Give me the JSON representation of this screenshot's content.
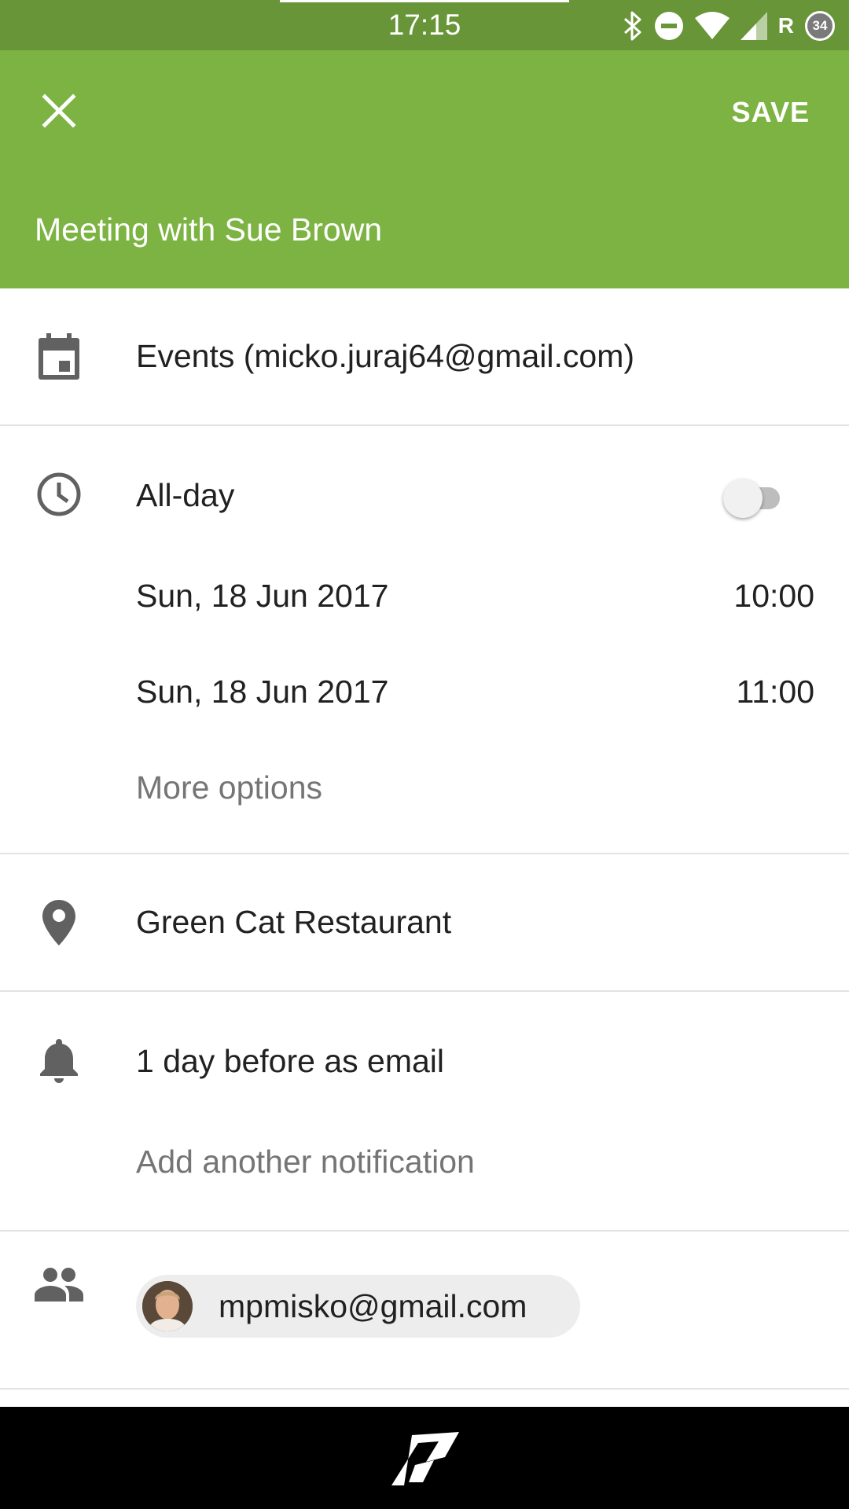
{
  "status_bar": {
    "time": "17:15",
    "carrier_indicator": "R",
    "battery_level": "34",
    "icons": [
      "bluetooth-icon",
      "do-not-disturb-icon",
      "wifi-icon",
      "cell-signal-icon"
    ]
  },
  "app_bar": {
    "close_icon": "close-icon",
    "save_label": "SAVE",
    "title": "Meeting with Sue Brown",
    "background_color": "#7cb342"
  },
  "calendar": {
    "icon": "calendar-icon",
    "label": "Events (micko.juraj64@gmail.com)"
  },
  "time_section": {
    "icon": "clock-icon",
    "all_day_label": "All-day",
    "all_day_enabled": false,
    "start_date": "Sun, 18 Jun 2017",
    "start_time": "10:00",
    "end_date": "Sun, 18 Jun 2017",
    "end_time": "11:00",
    "more_options": "More options"
  },
  "location": {
    "icon": "location-pin-icon",
    "value": "Green Cat Restaurant"
  },
  "notifications": {
    "icon": "bell-icon",
    "current": "1 day before as email",
    "add_label": "Add another notification"
  },
  "attendees": {
    "icon": "people-icon",
    "items": [
      {
        "email": "mpmisko@gmail.com",
        "avatar": "avatar-photo"
      }
    ]
  },
  "navigation_bar": {
    "home_icon": "home-logo-icon"
  }
}
